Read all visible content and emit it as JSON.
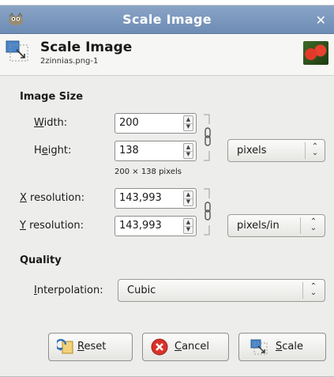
{
  "window": {
    "title": "Scale Image",
    "close_glyph": "✕"
  },
  "header": {
    "title": "Scale Image",
    "subtitle": "2zinnias.png-1",
    "thumbnail_icon": "zinnias-thumbnail"
  },
  "image_size": {
    "section_label": "Image Size",
    "width": {
      "label_u": "W",
      "label_rest": "idth:",
      "value": "200"
    },
    "height": {
      "label_pre": "H",
      "label_u": "e",
      "label_rest": "ight:",
      "value": "138"
    },
    "size_note": "200 × 138 pixels",
    "size_unit": "pixels",
    "x_resolution": {
      "label_u": "X",
      "label_rest": " resolution:",
      "value": "143,993"
    },
    "y_resolution": {
      "label_u": "Y",
      "label_rest": " resolution:",
      "value": "143,993"
    },
    "resolution_unit": "pixels/in"
  },
  "quality": {
    "section_label": "Quality",
    "interpolation": {
      "label_u": "I",
      "label_rest": "nterpolation:",
      "value": "Cubic"
    }
  },
  "buttons": {
    "reset": {
      "label_u": "R",
      "label_rest": "eset"
    },
    "cancel": {
      "label_u": "C",
      "label_rest": "ancel"
    },
    "scale": {
      "label_u": "S",
      "label_rest": "cale"
    }
  },
  "colors": {
    "titlebar": "#7894bc",
    "accent_red": "#d9322b",
    "window_bg": "#ededeb"
  }
}
